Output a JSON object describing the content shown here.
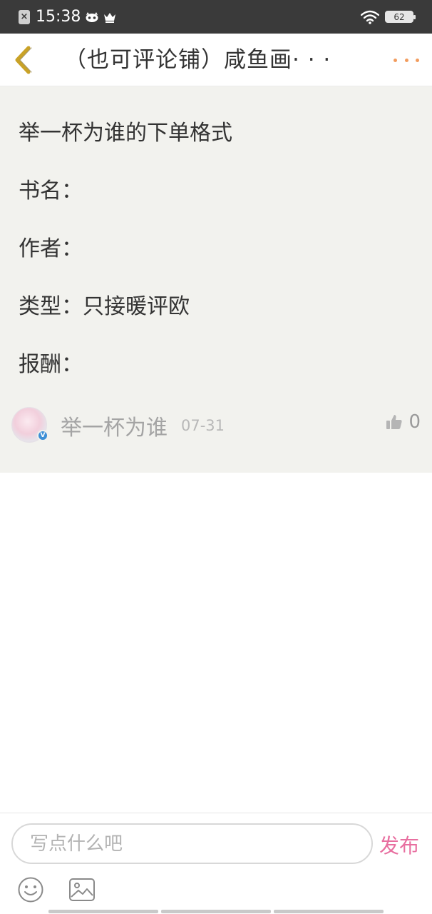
{
  "status_bar": {
    "time": "15:38",
    "battery_level": "62",
    "sim_icon": "sim-off-icon",
    "wifi_icon": "wifi-icon"
  },
  "nav": {
    "title": "（也可评论铺）咸鱼画· · ·",
    "back_icon": "chevron-left-icon",
    "more_icon": "more-dots-icon",
    "back_color": "#c9a227",
    "more_color": "#f29c5e"
  },
  "post": {
    "lines": [
      "举一杯为谁的下单格式",
      "书名：",
      "作者：",
      "类型：只接暖评欧",
      "报酬："
    ],
    "author": {
      "name": "举一杯为谁",
      "date": "07-31",
      "verified_badge": "V"
    },
    "likes": "0"
  },
  "comment_bar": {
    "placeholder": "写点什么吧",
    "value": "",
    "publish_label": "发布",
    "publish_color": "#e86fa0"
  },
  "colors": {
    "card_background": "#f2f2ee",
    "status_bar_background": "#3a3a3a"
  }
}
